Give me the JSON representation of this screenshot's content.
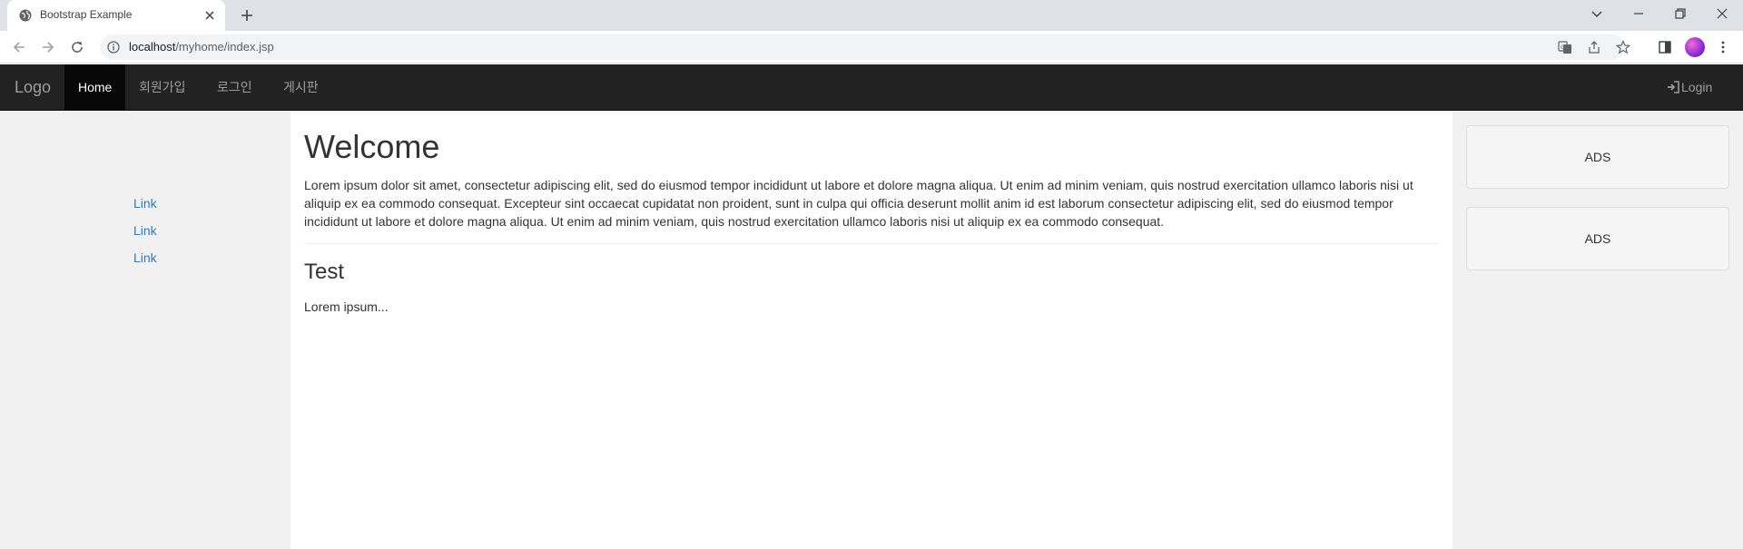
{
  "browser": {
    "tab_title": "Bootstrap Example",
    "url_host": "localhost",
    "url_path": "/myhome/index.jsp"
  },
  "navbar": {
    "brand": "Logo",
    "items": [
      {
        "label": "Home",
        "active": true
      },
      {
        "label": "회원가입",
        "active": false
      },
      {
        "label": "로그인",
        "active": false
      },
      {
        "label": "게시판",
        "active": false
      }
    ],
    "login_label": "Login"
  },
  "sidebar_left": {
    "links": [
      "Link",
      "Link",
      "Link"
    ]
  },
  "main": {
    "heading": "Welcome",
    "paragraph": "Lorem ipsum dolor sit amet, consectetur adipiscing elit, sed do eiusmod tempor incididunt ut labore et dolore magna aliqua. Ut enim ad minim veniam, quis nostrud exercitation ullamco laboris nisi ut aliquip ex ea commodo consequat. Excepteur sint occaecat cupidatat non proident, sunt in culpa qui officia deserunt mollit anim id est laborum consectetur adipiscing elit, sed do eiusmod tempor incididunt ut labore et dolore magna aliqua. Ut enim ad minim veniam, quis nostrud exercitation ullamco laboris nisi ut aliquip ex ea commodo consequat.",
    "subheading": "Test",
    "sub_text": "Lorem ipsum..."
  },
  "sidebar_right": {
    "ads": [
      "ADS",
      "ADS"
    ]
  },
  "colors": {
    "navbar_bg": "#222222",
    "navbar_active_bg": "#080808",
    "sidenav_bg": "#f1f1f1",
    "link": "#337ab7"
  }
}
